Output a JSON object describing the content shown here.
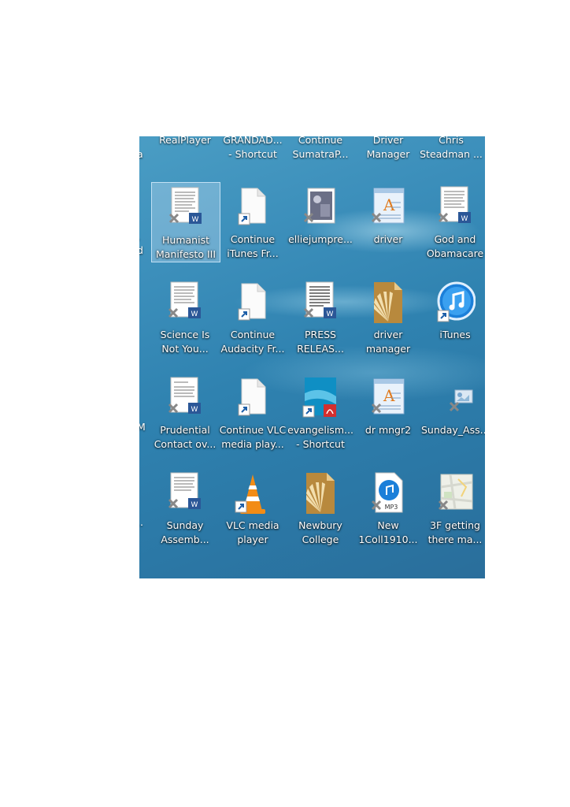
{
  "top_row": [
    {
      "line1": "RealPlayer",
      "line2": ""
    },
    {
      "line1": "GRANDAD...",
      "line2": "- Shortcut"
    },
    {
      "line1": "Continue",
      "line2": "SumatraP..."
    },
    {
      "line1": "Driver",
      "line2": "Manager"
    },
    {
      "line1": "Chris",
      "line2": "Steadman ..."
    }
  ],
  "cutoff_left": {
    "row0": "a",
    "row1a": ",",
    "row1b": "d",
    "row3": "M",
    "row4": ".."
  },
  "rows": [
    [
      {
        "line1": "Humanist",
        "line2": "Manifesto III",
        "icon": "word-doc-icon",
        "selected": true
      },
      {
        "line1": "Continue",
        "line2": "iTunes Fr...",
        "icon": "blank-file-shortcut-icon"
      },
      {
        "line1": "elliejumpre...",
        "line2": "",
        "icon": "photo-file-icon"
      },
      {
        "line1": "driver",
        "line2": "",
        "icon": "text-file-icon"
      },
      {
        "line1": "God and",
        "line2": "Obamacare",
        "icon": "word-doc-icon"
      }
    ],
    [
      {
        "line1": "Science Is",
        "line2": "Not You...",
        "icon": "word-doc-icon"
      },
      {
        "line1": "Continue",
        "line2": "Audacity Fr...",
        "icon": "blank-file-shortcut-icon"
      },
      {
        "line1": "PRESS",
        "line2": "RELEAS...",
        "icon": "word-doc-icon"
      },
      {
        "line1": "driver",
        "line2": "manager",
        "icon": "burst-file-icon"
      },
      {
        "line1": "iTunes",
        "line2": "",
        "icon": "itunes-icon"
      }
    ],
    [
      {
        "line1": "Prudential",
        "line2": "Contact ov...",
        "icon": "word-doc-icon"
      },
      {
        "line1": "Continue VLC",
        "line2": "media play...",
        "icon": "blank-file-shortcut-icon"
      },
      {
        "line1": "evangelism...",
        "line2": "- Shortcut",
        "icon": "pdf-shortcut-icon"
      },
      {
        "line1": "dr mngr2",
        "line2": "",
        "icon": "text-file-icon"
      },
      {
        "line1": "Sunday_Ass...",
        "line2": "",
        "icon": "small-image-icon"
      }
    ],
    [
      {
        "line1": "Sunday",
        "line2": "Assemb...",
        "icon": "word-doc-icon"
      },
      {
        "line1": "VLC media",
        "line2": "player",
        "icon": "vlc-icon"
      },
      {
        "line1": "Newbury",
        "line2": "College",
        "icon": "burst-file-icon"
      },
      {
        "line1": "New",
        "line2": "1Coll1910...",
        "icon": "mp3-file-icon"
      },
      {
        "line1": "3F getting",
        "line2": "there ma...",
        "icon": "map-file-icon"
      }
    ]
  ],
  "colors": {
    "desktop_background": "#2f82b0",
    "label_text": "#ffffff",
    "word_blue": "#2b5797",
    "pdf_red": "#d32f2f",
    "vlc_orange": "#f28c16",
    "burst_brown": "#b8893d"
  }
}
